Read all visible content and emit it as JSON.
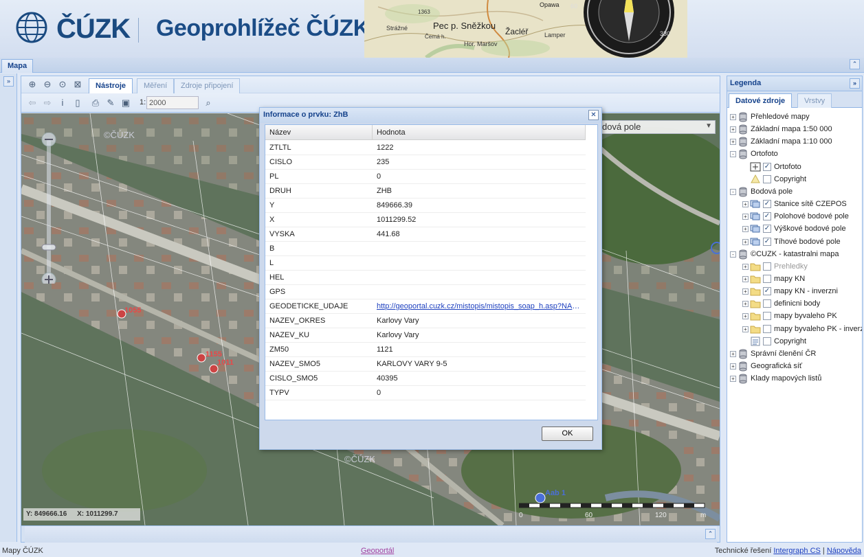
{
  "header": {
    "logo_text": "ČÚZK",
    "title": "Geoprohlížeč ČÚZK",
    "map_labels": [
      "Pec p. Sněžkou",
      "Strážné",
      "Žacléř",
      "Hor. Maršov",
      "Opawa",
      "Lamper",
      "Černá h.",
      "1363"
    ]
  },
  "main_tab": {
    "label": "Mapa"
  },
  "toolbar": {
    "tabs": [
      "Nástroje",
      "Měření",
      "Zdroje připojení"
    ],
    "active_tab": "Nástroje",
    "scale_prefix": "1:",
    "scale_value": "2000"
  },
  "map": {
    "layer_select": "dová pole",
    "coord_y": "Y: 849666.16",
    "coord_x": "X: 1011299.7",
    "scale_labels": [
      "0",
      "60",
      "120",
      "m"
    ],
    "labels": [
      "1055",
      "1155",
      "1011",
      "Aab 1",
      "©ČÚZK",
      "©ČÚZK"
    ]
  },
  "dialog": {
    "title": "Informace o prvku: ZhB",
    "col_name": "Název",
    "col_value": "Hodnota",
    "rows": [
      {
        "name": "ZTLTL",
        "value": "1222"
      },
      {
        "name": "CISLO",
        "value": "235"
      },
      {
        "name": "PL",
        "value": "0"
      },
      {
        "name": "DRUH",
        "value": "ZHB"
      },
      {
        "name": "Y",
        "value": "849666.39"
      },
      {
        "name": "X",
        "value": "1011299.52"
      },
      {
        "name": "VYSKA",
        "value": "441.68"
      },
      {
        "name": "B",
        "value": ""
      },
      {
        "name": "L",
        "value": ""
      },
      {
        "name": "HEL",
        "value": ""
      },
      {
        "name": "GPS",
        "value": ""
      },
      {
        "name": "GEODETICKE_UDAJE",
        "value": "http://geoportal.cuzk.cz/mistopis/mistopis_soap_h.asp?NAM...",
        "link": true
      },
      {
        "name": "NAZEV_OKRES",
        "value": "Karlovy Vary"
      },
      {
        "name": "NAZEV_KU",
        "value": "Karlovy Vary"
      },
      {
        "name": "ZM50",
        "value": "1121"
      },
      {
        "name": "NAZEV_SMO5",
        "value": "KARLOVY VARY 9-5"
      },
      {
        "name": "CISLO_SMO5",
        "value": "40395"
      },
      {
        "name": "TYPV",
        "value": "0"
      }
    ],
    "ok_label": "OK"
  },
  "legend": {
    "title": "Legenda",
    "tabs": [
      "Datové zdroje",
      "Vrstvy"
    ],
    "active_tab": "Datové zdroje",
    "items": [
      {
        "label": "Přehledové mapy",
        "level": 0,
        "expander": "+",
        "icon": "server"
      },
      {
        "label": "Základní mapa 1:50 000",
        "level": 0,
        "expander": "+",
        "icon": "server"
      },
      {
        "label": "Základní mapa 1:10 000",
        "level": 0,
        "expander": "+",
        "icon": "server"
      },
      {
        "label": "Ortofoto",
        "level": 0,
        "expander": "-",
        "icon": "server"
      },
      {
        "label": "Ortofoto",
        "level": 1,
        "expander": "",
        "icon": "raster",
        "checked": true
      },
      {
        "label": "Copyright",
        "level": 1,
        "expander": "",
        "icon": "note",
        "checked": false
      },
      {
        "label": "Bodová pole",
        "level": 0,
        "expander": "-",
        "icon": "server"
      },
      {
        "label": "Stanice sítě CZEPOS",
        "level": 1,
        "expander": "+",
        "icon": "layers",
        "checked": true
      },
      {
        "label": "Polohové bodové pole",
        "level": 1,
        "expander": "+",
        "icon": "layers",
        "checked": true
      },
      {
        "label": "Výškové bodové pole",
        "level": 1,
        "expander": "+",
        "icon": "layers",
        "checked": true
      },
      {
        "label": "Tíhové bodové pole",
        "level": 1,
        "expander": "+",
        "icon": "layers",
        "checked": true
      },
      {
        "label": "©CUZK - katastralni mapa",
        "level": 0,
        "expander": "-",
        "icon": "server"
      },
      {
        "label": "Prehledky",
        "level": 1,
        "expander": "+",
        "icon": "folder",
        "checked": false,
        "dim": true
      },
      {
        "label": "mapy KN",
        "level": 1,
        "expander": "+",
        "icon": "folder",
        "checked": false
      },
      {
        "label": "mapy KN - inverzni",
        "level": 1,
        "expander": "+",
        "icon": "folder",
        "checked": true
      },
      {
        "label": "definicni body",
        "level": 1,
        "expander": "+",
        "icon": "folder",
        "checked": false
      },
      {
        "label": "mapy byvaleho PK",
        "level": 1,
        "expander": "+",
        "icon": "folder",
        "checked": false
      },
      {
        "label": "mapy byvaleho PK - inverzni",
        "level": 1,
        "expander": "+",
        "icon": "folder",
        "checked": false
      },
      {
        "label": "Copyright",
        "level": 1,
        "expander": "",
        "icon": "list",
        "checked": false
      },
      {
        "label": "Správní členění ČR",
        "level": 0,
        "expander": "+",
        "icon": "server"
      },
      {
        "label": "Geografická síť",
        "level": 0,
        "expander": "+",
        "icon": "server"
      },
      {
        "label": "Klady mapových listů",
        "level": 0,
        "expander": "+",
        "icon": "server"
      }
    ]
  },
  "statusbar": {
    "left": "Mapy ČÚZK",
    "middle": "Geoportál",
    "right_prefix": "Technické řešení",
    "right_link1": "Intergraph CS",
    "separator": "|",
    "right_link2": "Nápověda"
  },
  "colors": {
    "accent": "#15428b",
    "panel_bg": "#dfe8f6",
    "border": "#99bbe8",
    "link": "#1c3fbf"
  }
}
